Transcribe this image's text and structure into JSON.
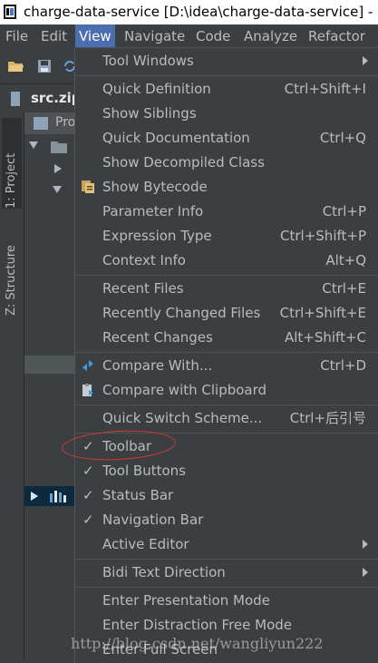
{
  "window": {
    "title": "charge-data-service [D:\\idea\\charge-data-service] - D:"
  },
  "menubar": {
    "file": "File",
    "edit": "Edit",
    "view": "View",
    "navigate": "Navigate",
    "code": "Code",
    "analyze": "Analyze",
    "refactor": "Refactor"
  },
  "navbar": {
    "crumb": "src.zip"
  },
  "side_tabs": {
    "project": "1: Project",
    "structure": "Z: Structure"
  },
  "project_panel": {
    "header": "Pro"
  },
  "view_menu": {
    "tool_windows": "Tool Windows",
    "quick_definition": {
      "label": "Quick Definition",
      "shortcut": "Ctrl+Shift+I"
    },
    "show_siblings": "Show Siblings",
    "quick_documentation": {
      "label": "Quick Documentation",
      "shortcut": "Ctrl+Q"
    },
    "show_decompiled_class": "Show Decompiled Class",
    "show_bytecode": "Show Bytecode",
    "parameter_info": {
      "label": "Parameter Info",
      "shortcut": "Ctrl+P"
    },
    "expression_type": {
      "label": "Expression Type",
      "shortcut": "Ctrl+Shift+P"
    },
    "context_info": {
      "label": "Context Info",
      "shortcut": "Alt+Q"
    },
    "recent_files": {
      "label": "Recent Files",
      "shortcut": "Ctrl+E"
    },
    "recently_changed_files": {
      "label": "Recently Changed Files",
      "shortcut": "Ctrl+Shift+E"
    },
    "recent_changes": {
      "label": "Recent Changes",
      "shortcut": "Alt+Shift+C"
    },
    "compare_with": {
      "label": "Compare With...",
      "shortcut": "Ctrl+D"
    },
    "compare_with_clipboard": "Compare with Clipboard",
    "quick_switch_scheme": {
      "label": "Quick Switch Scheme...",
      "shortcut": "Ctrl+后引号"
    },
    "toolbar": "Toolbar",
    "tool_buttons": "Tool Buttons",
    "status_bar": "Status Bar",
    "navigation_bar": "Navigation Bar",
    "active_editor": "Active Editor",
    "bidi_text_direction": "Bidi Text Direction",
    "enter_presentation_mode": "Enter Presentation Mode",
    "enter_distraction_free_mode": "Enter Distraction Free Mode",
    "enter_full_screen": "Enter Full Screen"
  },
  "watermark": "http://blog.csdn.net/wangliyun222",
  "colors": {
    "menu_highlight": "#4b6eaf",
    "annotation": "#d23a3a",
    "background": "#3c3f41"
  }
}
